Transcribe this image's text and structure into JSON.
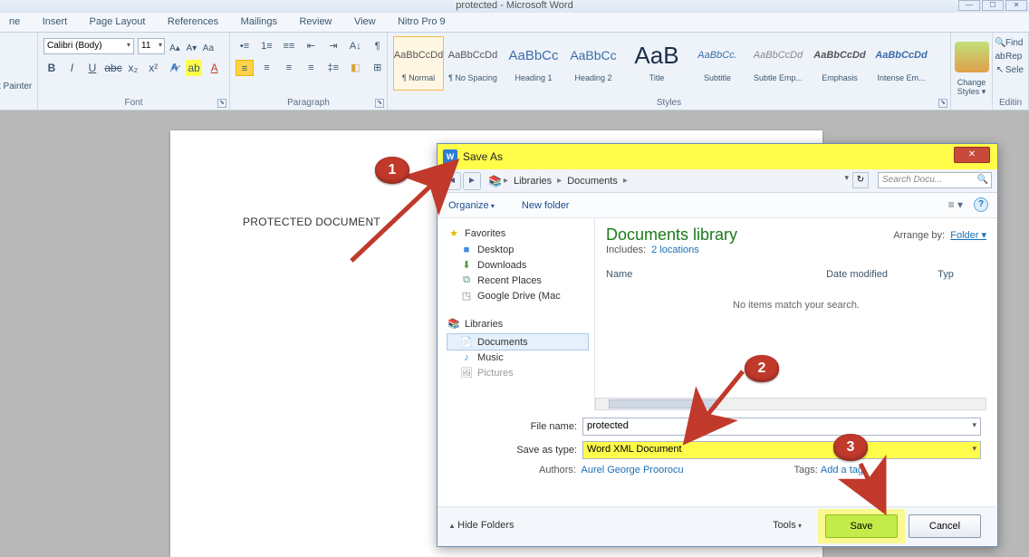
{
  "window": {
    "title": "protected - Microsoft Word"
  },
  "ribbon_tabs": {
    "home_partial": "ne",
    "insert": "Insert",
    "page_layout": "Page Layout",
    "references": "References",
    "mailings": "Mailings",
    "review": "Review",
    "view": "View",
    "nitro": "Nitro Pro 9"
  },
  "ribbon": {
    "clipboard": {
      "painter": "t Painter"
    },
    "font": {
      "label": "Font",
      "name": "Calibri (Body)",
      "size": "11"
    },
    "paragraph": {
      "label": "Paragraph"
    },
    "styles": {
      "label": "Styles",
      "items": [
        {
          "preview": "AaBbCcDd",
          "name": "¶ Normal"
        },
        {
          "preview": "AaBbCcDd",
          "name": "¶ No Spacing"
        },
        {
          "preview": "AaBbCc",
          "name": "Heading 1"
        },
        {
          "preview": "AaBbCc",
          "name": "Heading 2"
        },
        {
          "preview": "AaB",
          "name": "Title"
        },
        {
          "preview": "AaBbCc.",
          "name": "Subtitle"
        },
        {
          "preview": "AaBbCcDd",
          "name": "Subtle Emp..."
        },
        {
          "preview": "AaBbCcDd",
          "name": "Emphasis"
        },
        {
          "preview": "AaBbCcDd",
          "name": "Intense Em..."
        }
      ],
      "change": "Change Styles"
    },
    "editing": {
      "label": "Editin",
      "find": "Find",
      "replace": "Rep",
      "select": "Sele"
    }
  },
  "document": {
    "body_text": "PROTECTED DOCUMENT"
  },
  "dialog": {
    "title": "Save As",
    "nav": {
      "root": "Libraries",
      "folder": "Documents",
      "search_placeholder": "Search Docu..."
    },
    "toolbar": {
      "organize": "Organize",
      "new_folder": "New folder"
    },
    "sidebar": {
      "favorites_head": "Favorites",
      "desktop": "Desktop",
      "downloads": "Downloads",
      "recent": "Recent Places",
      "gdrive": "Google Drive (Mac",
      "libraries_head": "Libraries",
      "documents": "Documents",
      "music": "Music",
      "pictures_cut": "Pictures"
    },
    "main": {
      "title": "Documents library",
      "includes_label": "Includes:",
      "includes_link": "2 locations",
      "arrange_label": "Arrange by:",
      "arrange_value": "Folder",
      "col_name": "Name",
      "col_date": "Date modified",
      "col_type": "Typ",
      "no_items": "No items match your search."
    },
    "form": {
      "filename_label": "File name:",
      "filename_value": "protected",
      "type_label": "Save as type:",
      "type_value": "Word XML Document",
      "authors_label": "Authors:",
      "authors_value": "Aurel George Proorocu",
      "tags_label": "Tags:",
      "tags_value": "Add a tag"
    },
    "footer": {
      "hide_folders": "Hide Folders",
      "tools": "Tools",
      "save": "Save",
      "cancel": "Cancel"
    }
  },
  "callouts": {
    "one": "1",
    "two": "2",
    "three": "3"
  }
}
